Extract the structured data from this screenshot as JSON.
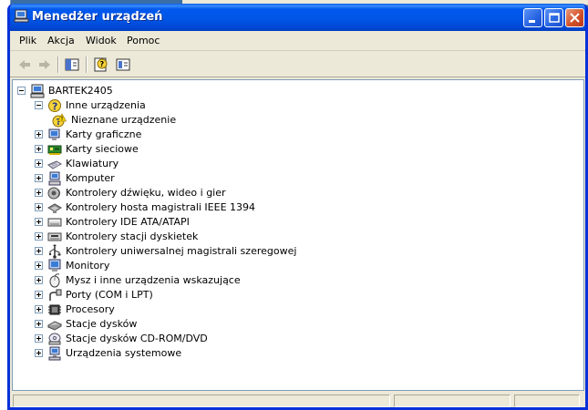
{
  "window": {
    "title": "Menedżer urządzeń"
  },
  "menu": [
    "Plik",
    "Akcja",
    "Widok",
    "Pomoc"
  ],
  "toolbar": {
    "buttons": [
      {
        "name": "back-icon"
      },
      {
        "name": "forward-icon"
      },
      {
        "name": "show-hide-tree-icon"
      },
      {
        "name": "properties-icon"
      },
      {
        "name": "view-icon"
      }
    ]
  },
  "tree": {
    "root": "BARTEK2405",
    "items": [
      {
        "label": "Inne urządzenia",
        "icon": "unknown-device-icon",
        "expanded": true
      },
      {
        "label": "Nieznane urządzenie",
        "icon": "warning-device-icon",
        "child": true
      },
      {
        "label": "Karty graficzne",
        "icon": "display-adapter-icon"
      },
      {
        "label": "Karty sieciowe",
        "icon": "network-card-icon"
      },
      {
        "label": "Klawiatury",
        "icon": "keyboard-icon"
      },
      {
        "label": "Komputer",
        "icon": "computer-icon"
      },
      {
        "label": "Kontrolery dźwięku, wideo i gier",
        "icon": "sound-icon"
      },
      {
        "label": "Kontrolery hosta magistrali IEEE 1394",
        "icon": "ieee1394-icon"
      },
      {
        "label": "Kontrolery IDE ATA/ATAPI",
        "icon": "ide-controller-icon"
      },
      {
        "label": "Kontrolery stacji dyskietek",
        "icon": "floppy-controller-icon"
      },
      {
        "label": "Kontrolery uniwersalnej magistrali szeregowej",
        "icon": "usb-icon"
      },
      {
        "label": "Monitory",
        "icon": "monitor-icon"
      },
      {
        "label": "Mysz i inne urządzenia wskazujące",
        "icon": "mouse-icon"
      },
      {
        "label": "Porty (COM i LPT)",
        "icon": "port-icon"
      },
      {
        "label": "Procesory",
        "icon": "processor-icon"
      },
      {
        "label": "Stacje dysków",
        "icon": "disk-drive-icon"
      },
      {
        "label": "Stacje dysków CD-ROM/DVD",
        "icon": "cdrom-icon"
      },
      {
        "label": "Urządzenia systemowe",
        "icon": "system-devices-icon"
      }
    ]
  }
}
